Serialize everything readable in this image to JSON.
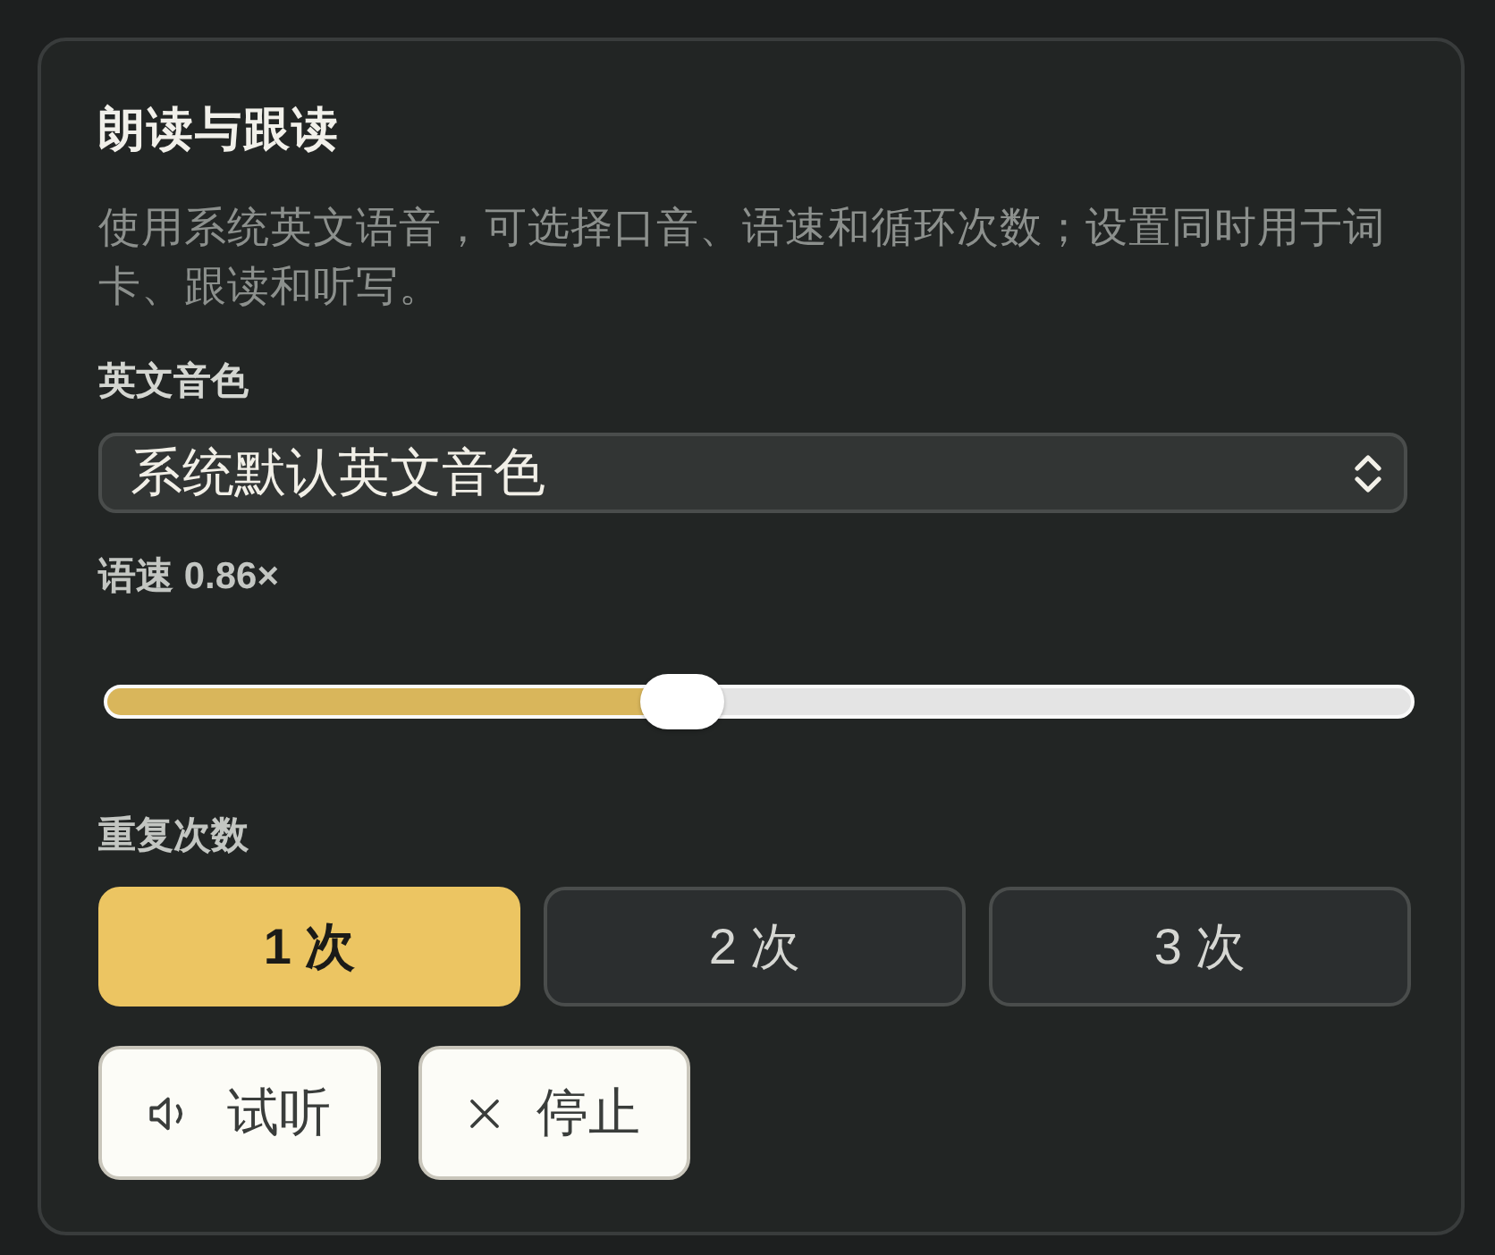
{
  "panel": {
    "title": "朗读与跟读",
    "description": "使用系统英文语音，可选择口音、语速和循环次数；设置同时用于词卡、跟读和听写。"
  },
  "voice": {
    "label": "英文音色",
    "value": "系统默认英文音色"
  },
  "speed": {
    "label": "语速 0.86×",
    "level": 0.44
  },
  "repeat": {
    "label": "重复次数",
    "options": [
      {
        "label": "1 次",
        "selected": true
      },
      {
        "label": "2 次",
        "selected": false
      },
      {
        "label": "3 次",
        "selected": false
      }
    ]
  },
  "actions": [
    {
      "kind": "play",
      "label": "试听"
    },
    {
      "kind": "stop",
      "label": "停止"
    }
  ]
}
